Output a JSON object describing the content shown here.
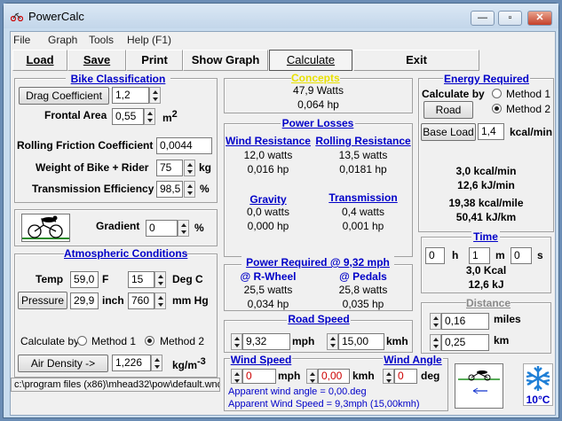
{
  "window": {
    "title": "PowerCalc",
    "minimize": "—",
    "maximize": "▫",
    "close": "✕"
  },
  "menu": [
    "File",
    "Graph",
    "Tools",
    "Help (F1)"
  ],
  "toolbar": {
    "load": "Load",
    "save": "Save",
    "print": "Print",
    "show_graph": "Show Graph",
    "calculate": "Calculate",
    "exit": "Exit"
  },
  "bike": {
    "title": "Bike Classification",
    "drag_btn": "Drag Coefficient",
    "drag": "1,2",
    "area_lbl": "Frontal Area",
    "area": "0,55",
    "area_unit": "m",
    "area_sup": "2",
    "rolling_lbl": "Rolling Friction Coefficient",
    "rolling": "0,0044",
    "weight_lbl": "Weight of Bike + Rider",
    "weight": "75",
    "weight_unit": "kg",
    "trans_lbl": "Transmission Efficiency",
    "trans": "98,5",
    "trans_unit": "%"
  },
  "gradient": {
    "label": "Gradient",
    "value": "0",
    "unit": "%"
  },
  "atmos": {
    "title": "Atmospheric Conditions",
    "temp_lbl": "Temp",
    "temp_f": "59,0",
    "f_unit": "F",
    "temp_c": "15",
    "c_unit": "Deg C",
    "pressure_btn": "Pressure",
    "pressure_in": "29,9",
    "in_unit": "inch",
    "pressure_mm": "760",
    "mm_unit": "mm Hg",
    "calc_by": "Calculate by",
    "method1": "Method 1",
    "method2": "Method 2",
    "density_btn": "Air Density ->",
    "density": "1,226",
    "density_unit": "kg/m",
    "density_sup": "-3"
  },
  "status": "c:\\program files (x86)\\mhead32\\pow\\default.wnd",
  "concept": {
    "title": "Concepts",
    "watts": "47,9 Watts",
    "hp": "0,064 hp"
  },
  "losses": {
    "title": "Power Losses",
    "wind_lbl": "Wind Resistance",
    "wind_w": "12,0 watts",
    "wind_hp": "0,016 hp",
    "rolling_lbl": "Rolling Resistance",
    "rolling_w": "13,5 watts",
    "rolling_hp": "0,0181 hp",
    "gravity_lbl": "Gravity",
    "gravity_w": "0,0 watts",
    "gravity_hp": "0,000 hp",
    "trans_lbl": "Transmission",
    "trans_w": "0,4 watts",
    "trans_hp": "0,001 hp"
  },
  "required": {
    "title": "Power Required @  9,32 mph",
    "rwheel_lbl": "@ R-Wheel",
    "rwheel_w": "25,5 watts",
    "rwheel_hp": "0,034 hp",
    "pedals_lbl": "@ Pedals",
    "pedals_w": "25,8 watts",
    "pedals_hp": "0,035 hp"
  },
  "road": {
    "title": "Road Speed",
    "mph": "9,32",
    "mph_unit": "mph",
    "kmh": "15,00",
    "kmh_unit": "kmh"
  },
  "wind": {
    "speed_title": "Wind Speed",
    "mph": "0",
    "mph_unit": "mph",
    "kmh": "0,00",
    "kmh_unit": "kmh",
    "angle_title": "Wind Angle",
    "angle": "0",
    "angle_unit": "deg",
    "apparent_angle": "Apparent wind angle = 0,00.deg",
    "apparent_speed": "Apparent Wind Speed = 9,3mph (15,00kmh)"
  },
  "energy": {
    "title": "Energy Required",
    "calc_by": "Calculate by",
    "method1": "Method 1",
    "method2": "Method 2",
    "road_btn": "Road",
    "baseload_btn": "Base Load",
    "baseload": "1,4",
    "baseload_unit": "kcal/min",
    "kcal_min": "3,0 kcal/min",
    "kj_min": "12,6 kJ/min",
    "kcal_mile": "19,38 kcal/mile",
    "kj_km": "50,41 kJ/km"
  },
  "time": {
    "title": "Time",
    "h": "0",
    "h_unit": "h",
    "m": "1",
    "m_unit": "m",
    "s": "0",
    "s_unit": "s",
    "kcal": "3,0 Kcal",
    "kj": "12,6 kJ"
  },
  "distance": {
    "title": "Distance",
    "miles": "0,16",
    "miles_unit": "miles",
    "km": "0,25",
    "km_unit": "km"
  },
  "temp_icon": {
    "label": "10°C"
  }
}
